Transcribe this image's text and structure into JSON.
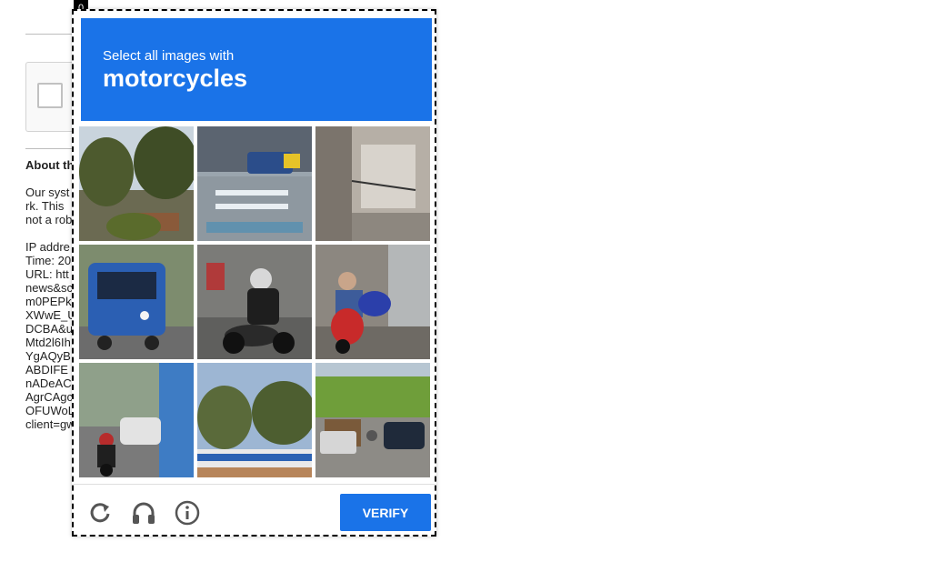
{
  "background": {
    "about_heading": "About th",
    "lines": [
      "Our syst",
      "rk. This",
      "not a rob",
      "",
      "IP addre",
      "Time: 20",
      "URL: htt",
      "news&sc",
      "m0PEPk",
      "XWwE_U",
      "DCBA&u",
      "Mtd2l6Ih",
      "YgAQyB",
      "ABDIFE",
      "nADeAC",
      "AgrCAgc",
      "OFUWoL",
      "client=gw"
    ]
  },
  "challenge": {
    "overlay_index": "0",
    "instruction": "Select all images with",
    "target": "motorcycles",
    "tiles": [
      {
        "index": 1,
        "description": "trees-and-roof"
      },
      {
        "index": 2,
        "description": "street-with-van"
      },
      {
        "index": 3,
        "description": "building-wall"
      },
      {
        "index": 4,
        "description": "bus-rear"
      },
      {
        "index": 5,
        "description": "motorcycle-rider"
      },
      {
        "index": 6,
        "description": "scooters-parked"
      },
      {
        "index": 7,
        "description": "traffic-with-motorcycle"
      },
      {
        "index": 8,
        "description": "trees-and-bus"
      },
      {
        "index": 9,
        "description": "road-with-vehicles"
      }
    ],
    "verify_label": "VERIFY",
    "icons": [
      "reload-icon",
      "audio-headphones-icon",
      "info-icon"
    ]
  },
  "colors": {
    "accent": "#1a73e8"
  }
}
